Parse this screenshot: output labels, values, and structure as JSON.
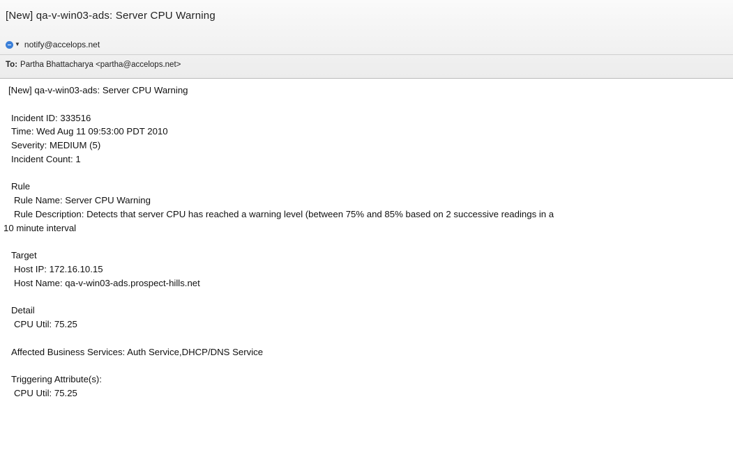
{
  "header": {
    "subject": "[New] qa-v-win03-ads: Server CPU Warning",
    "from": "notify@accelops.net",
    "sender_icon": "person-circle-icon",
    "to_label": "To:",
    "to_value": "Partha Bhattacharya <partha@accelops.net>"
  },
  "body": {
    "title": "[New] qa-v-win03-ads: Server CPU Warning",
    "incident_id": "Incident ID: 333516",
    "time": "Time: Wed Aug 11 09:53:00 PDT 2010",
    "severity": "Severity: MEDIUM (5)",
    "incident_count": "Incident Count: 1",
    "rule_heading": "Rule",
    "rule_name": "Rule Name: Server CPU Warning",
    "rule_description_1": "Rule Description: Detects that server CPU has reached a warning level (between 75% and 85% based on 2 successive readings in a",
    "rule_description_2": "10 minute interval",
    "target_heading": "Target",
    "host_ip": "Host IP: 172.16.10.15",
    "host_name": "Host Name: qa-v-win03-ads.prospect-hills.net",
    "detail_heading": "Detail",
    "detail_cpu": "CPU Util: 75.25",
    "affected_services": "Affected Business Services: Auth Service,DHCP/DNS Service",
    "triggering_heading": "Triggering Attribute(s):",
    "triggering_cpu": "CPU Util: 75.25"
  },
  "colors": {
    "header_bg": "#ececec",
    "sender_icon": "#3a7fd8"
  }
}
